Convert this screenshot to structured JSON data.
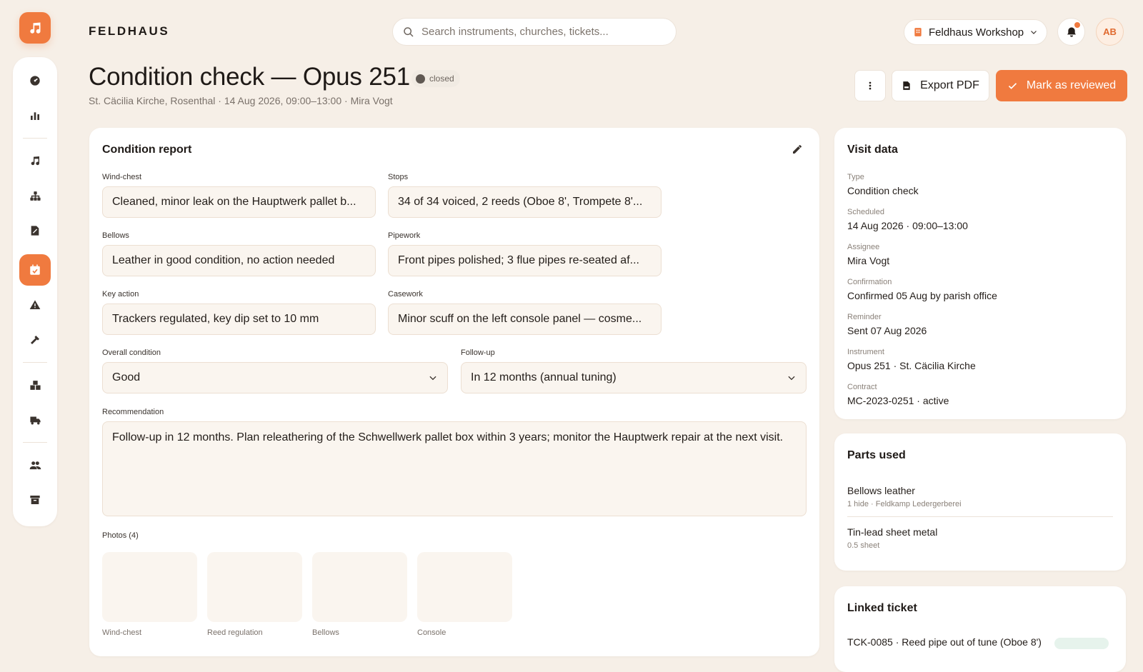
{
  "app": {
    "brand": "FELDHAUS"
  },
  "search": {
    "placeholder": "Search instruments, churches, tickets..."
  },
  "workspace": {
    "name": "Feldhaus Workshop"
  },
  "user": {
    "initials": "AB"
  },
  "nav": {
    "icons": [
      "dashboard-icon",
      "analytics-icon",
      "instruments-icon",
      "organization-icon",
      "reports-icon",
      "calendar-icon",
      "warning-icon",
      "tools-icon",
      "inventory-icon",
      "delivery-icon",
      "team-icon",
      "archive-icon"
    ],
    "active": "calendar-icon"
  },
  "page": {
    "title": "Condition check — Opus 251",
    "status": "closed",
    "subtitle": "St. Cäcilia Kirche, Rosenthal · 14 Aug 2026, 09:00–13:00 · Mira Vogt"
  },
  "actions": {
    "export_label": "Export PDF",
    "review_label": "Mark as reviewed"
  },
  "report": {
    "title": "Condition report",
    "fields": [
      {
        "label": "Wind-chest",
        "value": "Cleaned, minor leak on the Hauptwerk pallet b..."
      },
      {
        "label": "Stops",
        "value": "34 of 34 voiced, 2 reeds (Oboe 8', Trompete 8'..."
      },
      {
        "label": "Bellows",
        "value": "Leather in good condition, no action needed"
      },
      {
        "label": "Pipework",
        "value": "Front pipes polished; 3 flue pipes re-seated af..."
      },
      {
        "label": "Key action",
        "value": "Trackers regulated, key dip set to 10 mm"
      },
      {
        "label": "Casework",
        "value": "Minor scuff on the left console panel — cosme..."
      }
    ],
    "overall": {
      "label": "Overall condition",
      "value": "Good"
    },
    "followup": {
      "label": "Follow-up",
      "value": "In 12 months (annual tuning)"
    },
    "recommendation": {
      "label": "Recommendation",
      "value": "Follow-up in 12 months. Plan releathering of the Schwellwerk pallet box within 3 years; monitor the Hauptwerk repair at the next visit."
    },
    "photos": {
      "label": "Photos (4)",
      "items": [
        "Wind-chest",
        "Reed regulation",
        "Bellows",
        "Console"
      ]
    }
  },
  "visit": {
    "title": "Visit data",
    "rows": [
      {
        "label": "Type",
        "value": "Condition check"
      },
      {
        "label": "Scheduled",
        "value": "14 Aug 2026 · 09:00–13:00"
      },
      {
        "label": "Assignee",
        "value": "Mira Vogt"
      },
      {
        "label": "Confirmation",
        "value": "Confirmed 05 Aug by parish office"
      },
      {
        "label": "Reminder",
        "value": "Sent 07 Aug 2026"
      },
      {
        "label": "Instrument",
        "value": "Opus 251 · St. Cäcilia Kirche"
      },
      {
        "label": "Contract",
        "value": "MC-2023-0251 · active"
      }
    ]
  },
  "parts": {
    "title": "Parts used",
    "items": [
      {
        "name": "Bellows leather",
        "meta": "1 hide · Feldkamp Ledergerberei"
      },
      {
        "name": "Tin-lead sheet metal",
        "meta": "0.5 sheet"
      }
    ]
  },
  "ticket": {
    "title": "Linked ticket",
    "text": "TCK-0085 · Reed pipe out of tune (Oboe 8')"
  },
  "colors": {
    "accent": "#f07a3f",
    "background": "#f6efe7"
  }
}
